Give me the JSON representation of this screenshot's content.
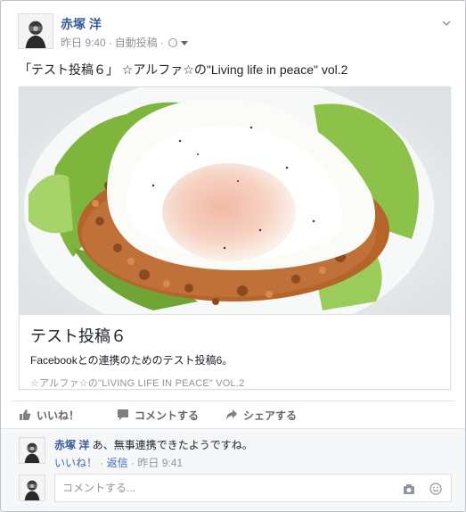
{
  "post": {
    "author": "赤塚 洋",
    "time": "昨日 9:40",
    "source": "自動投稿",
    "separator": "·",
    "text": "「テスト投稿６」 ☆アルファ☆の\"Living life in peace\" vol.2"
  },
  "link_preview": {
    "title": "テスト投稿６",
    "description": "Facebookとの連携のためのテスト投稿6。",
    "caption": "☆アルファ☆の\"LIVING LIFE IN PEACE\" VOL.2"
  },
  "actions": {
    "like": "いいね！",
    "comment": "コメントする",
    "share": "シェアする"
  },
  "comment": {
    "author": "赤塚 洋",
    "text": "あ、無事連携できたようですね。",
    "like": "いいね！",
    "reply": "返信",
    "sep": "·",
    "time": "昨日 9:41"
  },
  "comment_input": {
    "placeholder": "コメントする..."
  },
  "colors": {
    "link_blue": "#365899",
    "meta_gray": "#90949c",
    "action_gray": "#616770"
  },
  "icons": [
    "chevron-down-icon",
    "globe-icon",
    "caret-down-icon",
    "like-thumb-icon",
    "comment-bubble-icon",
    "share-arrow-icon",
    "camera-icon",
    "emoji-icon"
  ]
}
